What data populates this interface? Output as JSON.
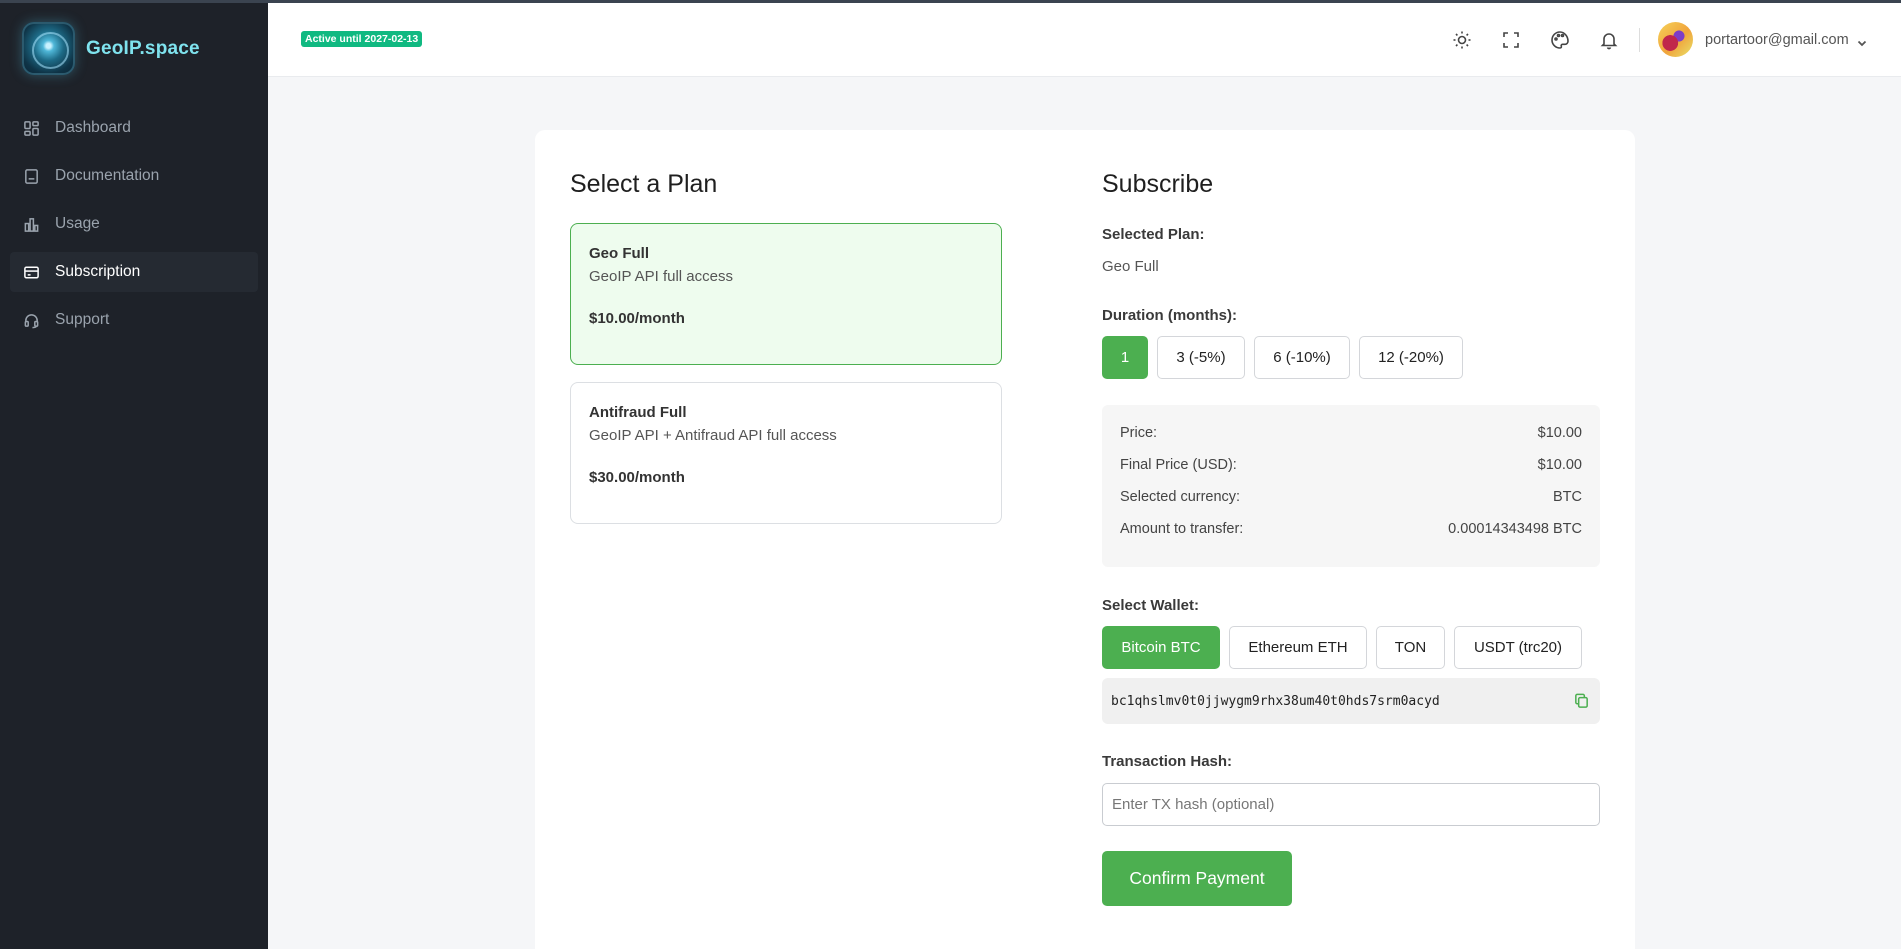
{
  "app": {
    "name": "GeoIP.space"
  },
  "sidebar": {
    "items": [
      {
        "label": "Dashboard",
        "icon": "dashboard-icon"
      },
      {
        "label": "Documentation",
        "icon": "book-icon"
      },
      {
        "label": "Usage",
        "icon": "bar-chart-icon"
      },
      {
        "label": "Subscription",
        "icon": "credit-card-icon",
        "active": true
      },
      {
        "label": "Support",
        "icon": "headset-icon"
      }
    ]
  },
  "header": {
    "status_badge": "Active until 2027-02-13",
    "user_email": "portartoor@gmail.com"
  },
  "plans": {
    "title": "Select a Plan",
    "items": [
      {
        "name": "Geo Full",
        "description": "GeoIP API full access",
        "price": "$10.00/month",
        "selected": true
      },
      {
        "name": "Antifraud Full",
        "description": "GeoIP API + Antifraud API full access",
        "price": "$30.00/month",
        "selected": false
      }
    ]
  },
  "subscribe": {
    "title": "Subscribe",
    "selected_plan_label": "Selected Plan:",
    "selected_plan_value": "Geo Full",
    "duration_label": "Duration (months):",
    "durations": [
      "1",
      "3 (-5%)",
      "6 (-10%)",
      "12 (-20%)"
    ],
    "active_duration": "1",
    "summary": [
      {
        "label": "Price:",
        "value": "$10.00"
      },
      {
        "label": "Final Price (USD):",
        "value": "$10.00"
      },
      {
        "label": "Selected currency:",
        "value": "BTC"
      },
      {
        "label": "Amount to transfer:",
        "value": "0.00014343498 BTC"
      }
    ],
    "wallet_label": "Select Wallet:",
    "wallets": [
      "Bitcoin BTC",
      "Ethereum ETH",
      "TON",
      "USDT (trc20)"
    ],
    "active_wallet": "Bitcoin BTC",
    "wallet_address": "bc1qhslmv0t0jjwygm9rhx38um40t0hds7srm0acyd",
    "tx_label": "Transaction Hash:",
    "tx_placeholder": "Enter TX hash (optional)",
    "tx_value": "",
    "confirm_label": "Confirm Payment"
  },
  "colors": {
    "accent": "#4caf50",
    "badge": "#10b981",
    "sidebar_bg": "#1e2229",
    "logo_text": "#7fe3ee"
  }
}
